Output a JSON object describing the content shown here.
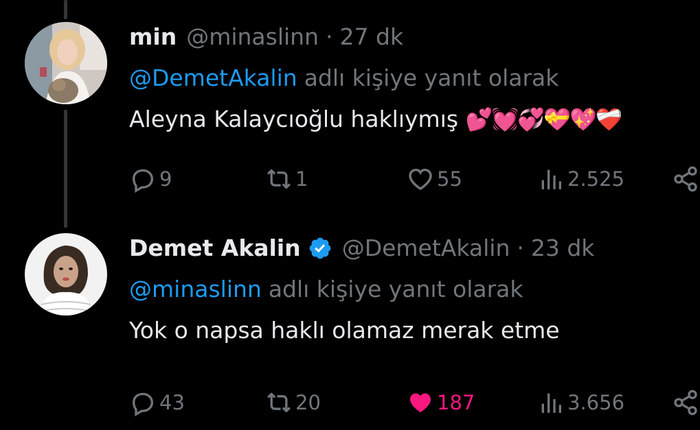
{
  "tweets": [
    {
      "display_name": "min",
      "handle": "@minaslinn",
      "separator": "·",
      "time": "27 dk",
      "verified": false,
      "reply_to": "@DemetAkalin",
      "reply_suffix": "adlı kişiye yanıt olarak",
      "text": "Aleyna Kalaycıoğlu haklıymış",
      "emojis": "💕💓💞💝💖❤️‍🩹",
      "replies": "9",
      "retweets": "1",
      "likes": "55",
      "views": "2.525",
      "liked": false
    },
    {
      "display_name": "Demet Akalin",
      "handle": "@DemetAkalin",
      "separator": "·",
      "time": "23 dk",
      "verified": true,
      "reply_to": "@minaslinn",
      "reply_suffix": "adlı kişiye yanıt olarak",
      "text": "Yok o napsa haklı olamaz merak etme",
      "replies": "43",
      "retweets": "20",
      "likes": "187",
      "views": "3.656",
      "liked": true
    }
  ],
  "colors": {
    "background": "#000000",
    "text": "#e7e9ea",
    "muted": "#71767b",
    "link": "#1d9bf0",
    "like": "#f91880",
    "thread_line": "#333639"
  },
  "icons": {
    "reply": "reply-icon",
    "retweet": "retweet-icon",
    "like": "heart-icon",
    "views": "views-icon",
    "share": "share-icon",
    "verified": "verified-badge-icon"
  }
}
